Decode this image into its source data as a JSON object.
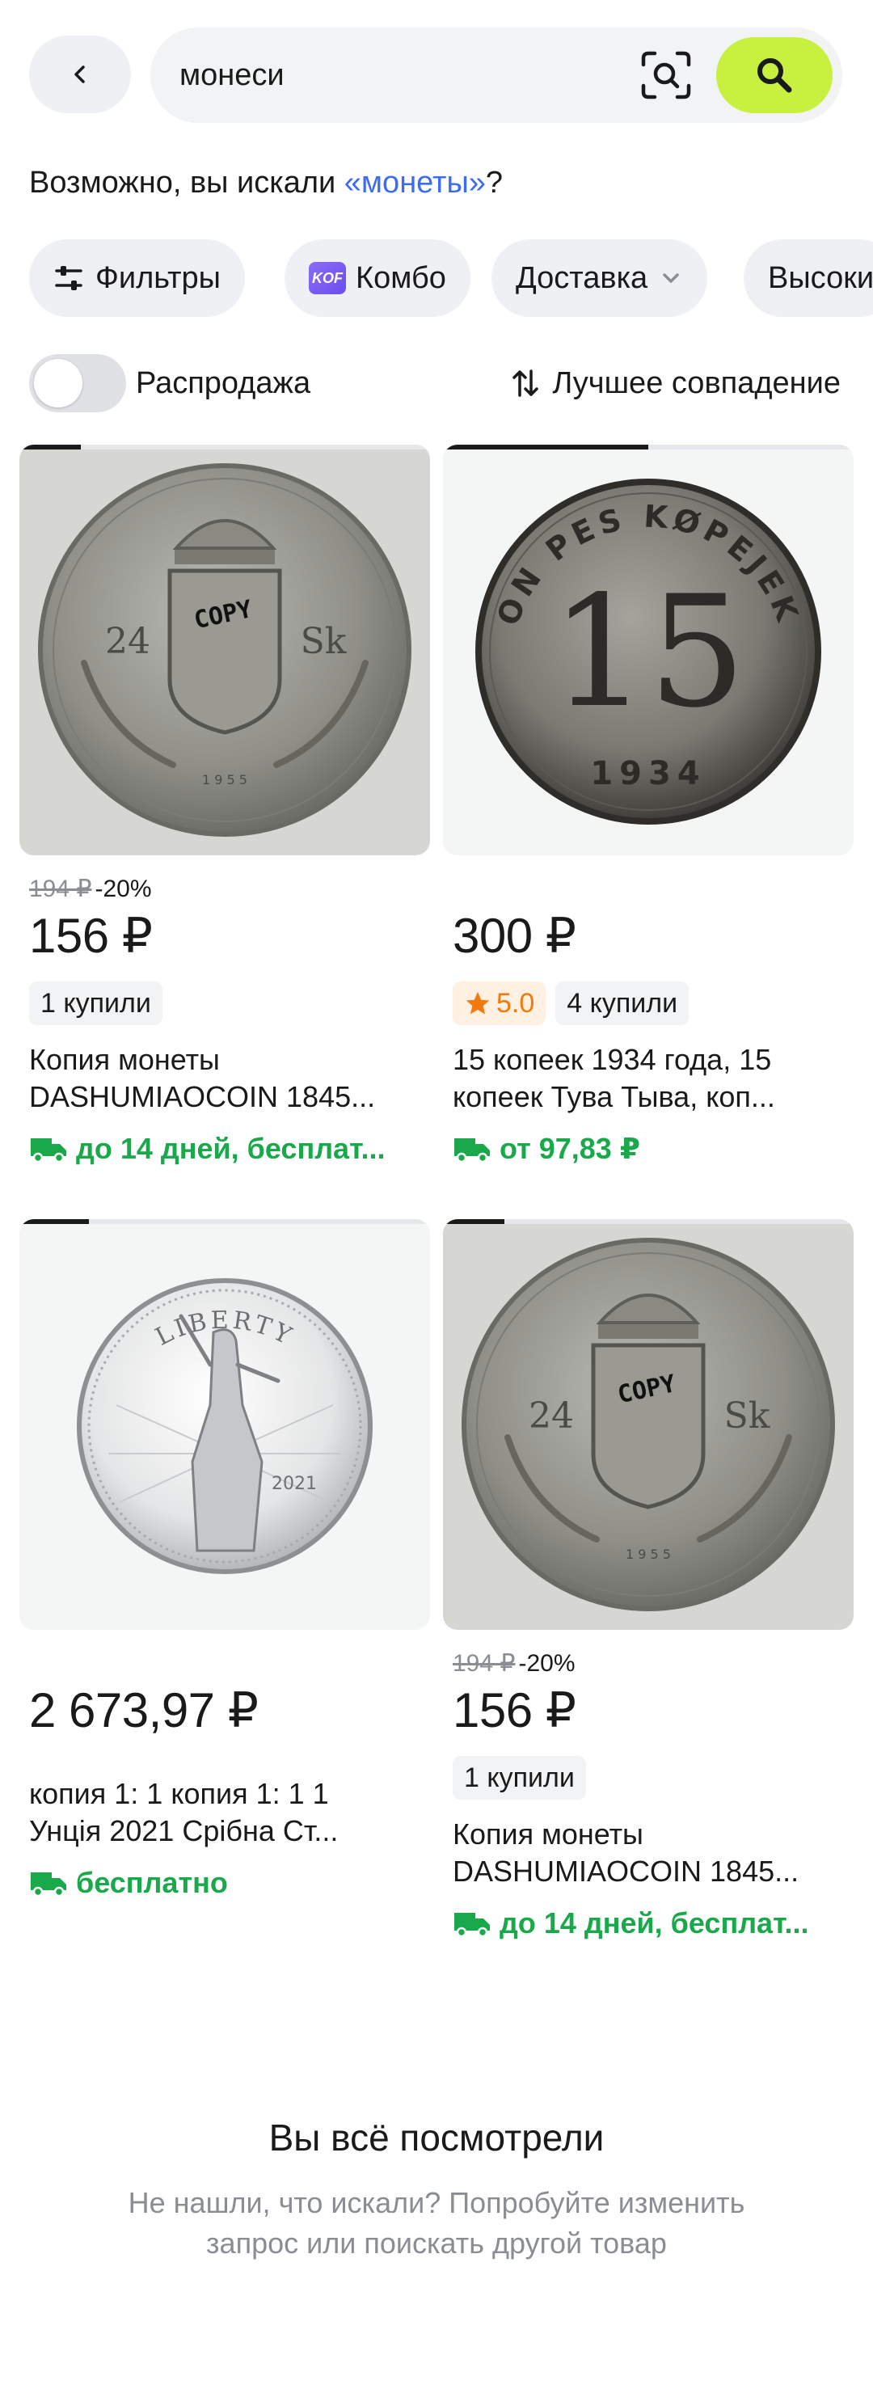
{
  "header": {
    "search_value": "монеси"
  },
  "suggestion": {
    "prefix": "Возможно, вы искали ",
    "link": "«монеты»",
    "suffix": "?"
  },
  "chips": [
    {
      "label": "Фильтры",
      "icon": "filters-icon"
    },
    {
      "label": "Комбо",
      "icon": "kombo-icon",
      "badge": "KOF"
    },
    {
      "label": "Доставка",
      "icon": "chevron-down-icon"
    },
    {
      "label": "Высоки"
    }
  ],
  "sale_toggle": {
    "label": "Распродажа",
    "on": false
  },
  "sort": {
    "label": "Лучшее совпадение"
  },
  "accent": {
    "green": "#19a94a",
    "lime": "#c8f03f",
    "blue": "#3d6cf4",
    "orange": "#f27a0c"
  },
  "products": [
    {
      "old_price": "194 ₽",
      "discount": "-20%",
      "price": "156 ₽",
      "buyers": "1 купили",
      "title_line1": "Копия монеты",
      "title_line2": "DASHUMIAOCOIN 1845...",
      "delivery": "до 14 дней, бесплат...",
      "image": "coin-24sk-copy",
      "progress": 0.15
    },
    {
      "price": "300 ₽",
      "rating": "5.0",
      "buyers": "4 купили",
      "title_line1": "15 копеек 1934 года, 15",
      "title_line2": "копеек Тува Тыва, коп...",
      "delivery": "от 97,83 ₽",
      "image": "coin-15-kopejek-1934",
      "progress": 0.5
    },
    {
      "price": "2 673,97 ₽",
      "title_line1": "копия 1: 1 копия 1: 1 1",
      "title_line2": "Унція 2021 Срібна Ст...",
      "delivery": "бесплатно",
      "image": "coin-liberty-2021",
      "progress": 0.17
    },
    {
      "old_price": "194 ₽",
      "discount": "-20%",
      "price": "156 ₽",
      "buyers": "1 купили",
      "title_line1": "Копия монеты",
      "title_line2": "DASHUMIAOCOIN 1845...",
      "delivery": "до 14 дней, бесплат...",
      "image": "coin-24sk-copy",
      "progress": 0.15
    }
  ],
  "coin_text": {
    "copy": "COPY",
    "sk_left": "24",
    "sk_right": "Sk",
    "sk_year": "1 9 5 5",
    "k15_num": "15",
    "k15_arc": "ON PES KØPEJEK",
    "k15_year": "1934",
    "lib_arc": "LIBERTY",
    "lib_year": "2021"
  },
  "end": {
    "title": "Вы всё посмотрели",
    "sub_line1": "Не нашли, что искали? Попробуйте изменить",
    "sub_line2": "запрос или поискать другой товар"
  }
}
